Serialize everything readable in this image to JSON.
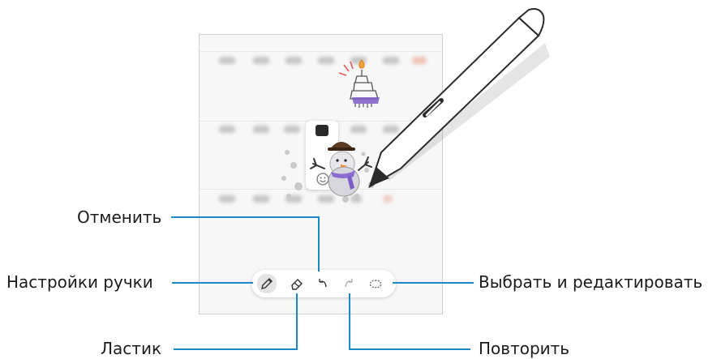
{
  "annotations": {
    "undo": "Отменить",
    "pen_settings": "Настройки ручки",
    "eraser": "Ластик",
    "redo": "Повторить",
    "select_edit": "Выбрать и редактировать"
  },
  "toolbar": {
    "tools": [
      "pen-settings",
      "eraser",
      "undo",
      "redo",
      "selection"
    ]
  },
  "colors": {
    "leader": "#1a87c9",
    "sketch_ink": "#6b56b5",
    "flame": "#f2a33a"
  }
}
